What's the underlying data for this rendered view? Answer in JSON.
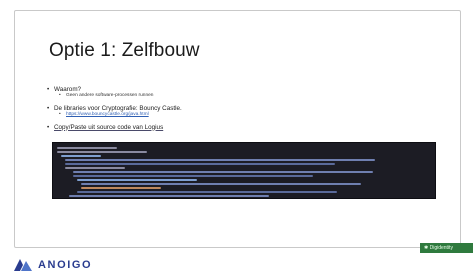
{
  "slide": {
    "title": "Optie 1: Zelfbouw",
    "bullets": [
      {
        "text": "Waarom?",
        "sub": [
          {
            "text": "Geen andere software-processen runnen"
          }
        ]
      },
      {
        "text": "De libraries voor Cryptografie: Bouncy Castle.",
        "sub": [
          {
            "text": "https://www.bouncycastle.org/java.html",
            "is_link": true
          }
        ]
      },
      {
        "text": "Copy/Paste uit source code van Logius"
      }
    ]
  },
  "footer": {
    "logo_text": "ANOIGO",
    "badge_text": "Digidentity"
  },
  "colors": {
    "title": "#1b1b1b",
    "link": "#2f5fb3",
    "code_bg": "#1c1c24",
    "logo": "#2a3c8f",
    "badge_bg": "#2f7a3e"
  }
}
